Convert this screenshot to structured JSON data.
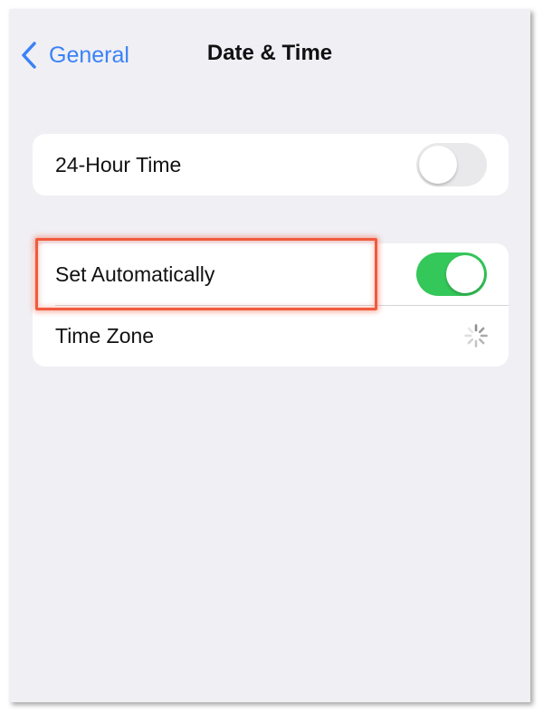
{
  "navbar": {
    "back_label": "General",
    "title": "Date & Time",
    "back_icon": "chevron-left-icon"
  },
  "settings": {
    "hour24": {
      "label": "24-Hour Time",
      "enabled": false
    },
    "set_automatically": {
      "label": "Set Automatically",
      "enabled": true
    },
    "time_zone": {
      "label": "Time Zone",
      "status_icon": "loading-spinner-icon"
    }
  },
  "colors": {
    "accent": "#3a82f7",
    "toggle_on": "#34c759",
    "toggle_off": "#e9e9eb",
    "highlight": "#f15a3c",
    "background": "#f0eff4"
  }
}
